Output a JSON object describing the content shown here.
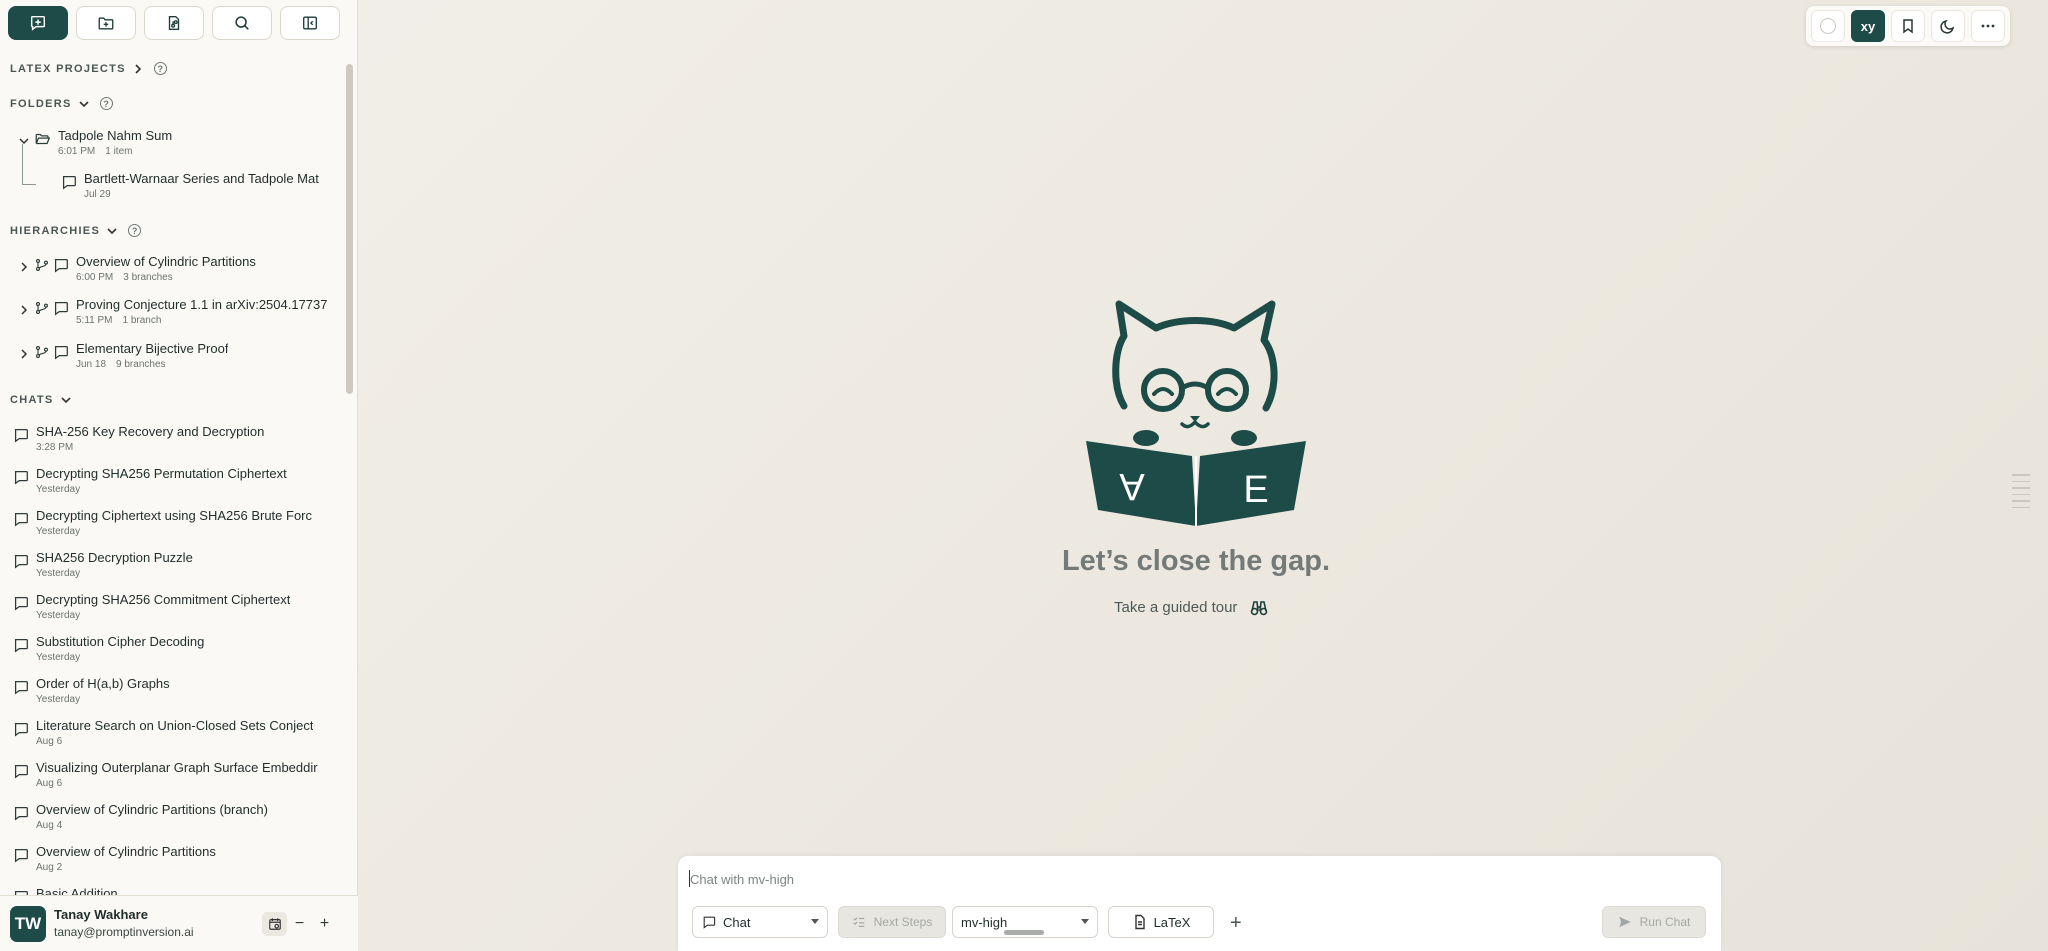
{
  "colors": {
    "brand": "#1d4b47",
    "background": "#f0ede6",
    "sidebar": "#fbf9f5"
  },
  "sidebar": {
    "top_buttons": [
      {
        "icon": "new-chat-icon"
      },
      {
        "icon": "new-folder-icon"
      },
      {
        "icon": "new-hierarchy-icon"
      },
      {
        "icon": "search-icon"
      },
      {
        "icon": "collapse-sidebar-icon"
      }
    ],
    "sections": {
      "latex_projects": "LATEX PROJECTS",
      "folders": "FOLDERS",
      "hierarchies": "HIERARCHIES",
      "chats": "CHATS",
      "help_glyph": "?"
    },
    "folders": [
      {
        "title": "Tadpole Nahm Sum",
        "time": "6:01 PM",
        "count": "1 item",
        "children": [
          {
            "title": "Bartlett-Warnaar Series and Tadpole Mat",
            "time": "Jul 29"
          }
        ]
      }
    ],
    "hierarchies": [
      {
        "title": "Overview of Cylindric Partitions",
        "time": "6:00 PM",
        "branches": "3 branches"
      },
      {
        "title": "Proving Conjecture 1.1 in arXiv:2504.17737",
        "time": "5:11 PM",
        "branches": "1 branch"
      },
      {
        "title": "Elementary Bijective Proof",
        "time": "Jun 18",
        "branches": "9 branches"
      }
    ],
    "chats": [
      {
        "title": "SHA-256 Key Recovery and Decryption",
        "time": "3:28 PM"
      },
      {
        "title": "Decrypting SHA256 Permutation Ciphertext",
        "time": "Yesterday"
      },
      {
        "title": "Decrypting Ciphertext using SHA256 Brute Forc",
        "time": "Yesterday"
      },
      {
        "title": "SHA256 Decryption Puzzle",
        "time": "Yesterday"
      },
      {
        "title": "Decrypting SHA256 Commitment Ciphertext",
        "time": "Yesterday"
      },
      {
        "title": "Substitution Cipher Decoding",
        "time": "Yesterday"
      },
      {
        "title": "Order of H(a,b) Graphs",
        "time": "Yesterday"
      },
      {
        "title": "Literature Search on Union-Closed Sets Conject",
        "time": "Aug 6"
      },
      {
        "title": "Visualizing Outerplanar Graph Surface Embeddir",
        "time": "Aug 6"
      },
      {
        "title": "Overview of Cylindric Partitions (branch)",
        "time": "Aug 4"
      },
      {
        "title": "Overview of Cylindric Partitions",
        "time": "Aug 2"
      },
      {
        "title": "Basic Addition",
        "time": ""
      }
    ],
    "user": {
      "initials": "TW",
      "name": "Tanay Wakhare",
      "email": "tanay@promptinversion.ai",
      "minus": "−",
      "plus": "+"
    }
  },
  "top_right": {
    "xy_label": "xy"
  },
  "hero": {
    "tagline": "Let’s close the gap.",
    "tour_label": "Take a guided tour",
    "book_left": "A",
    "book_right": "E"
  },
  "composer": {
    "placeholder": "Chat with mv-high",
    "mode": "Chat",
    "next_steps": "Next Steps",
    "model": "mv-high",
    "latex": "LaTeX",
    "add": "+",
    "run": "Run Chat"
  }
}
